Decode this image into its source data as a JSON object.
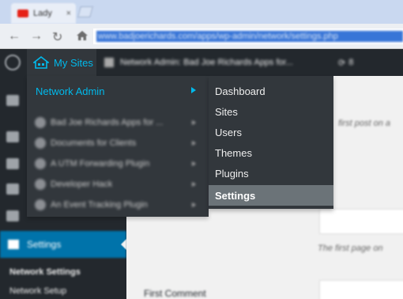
{
  "browser": {
    "tab_title": "Lady",
    "tab_close": "×",
    "back": "←",
    "forward": "→",
    "reload": "↻",
    "url": "www.badjoerichards.com/apps/wp-admin/network/settings.php"
  },
  "adminbar": {
    "my_sites": "My Sites",
    "site_crumb": "Network Admin: Bad Joe Richards Apps for...",
    "updates_count": "8"
  },
  "network_menu": {
    "header": "Network Admin",
    "sites": [
      {
        "label": "Bad Joe Richards Apps for ..."
      },
      {
        "label": "Documents for Clients"
      },
      {
        "label": "A UTM Forwarding Plugin"
      },
      {
        "label": "Developer Hack"
      },
      {
        "label": "An Event Tracking Plugin"
      }
    ]
  },
  "network_submenu": {
    "items": [
      {
        "label": "Dashboard"
      },
      {
        "label": "Sites"
      },
      {
        "label": "Users"
      },
      {
        "label": "Themes"
      },
      {
        "label": "Plugins"
      },
      {
        "label": "Settings",
        "active": true
      }
    ]
  },
  "sidebar": {
    "settings_label": "Settings",
    "sub_items": [
      "Network Settings",
      "Network Setup"
    ]
  },
  "content": {
    "hint1": "first post on a",
    "hint2": "The first page on",
    "first_comment_label": "First Comment"
  }
}
